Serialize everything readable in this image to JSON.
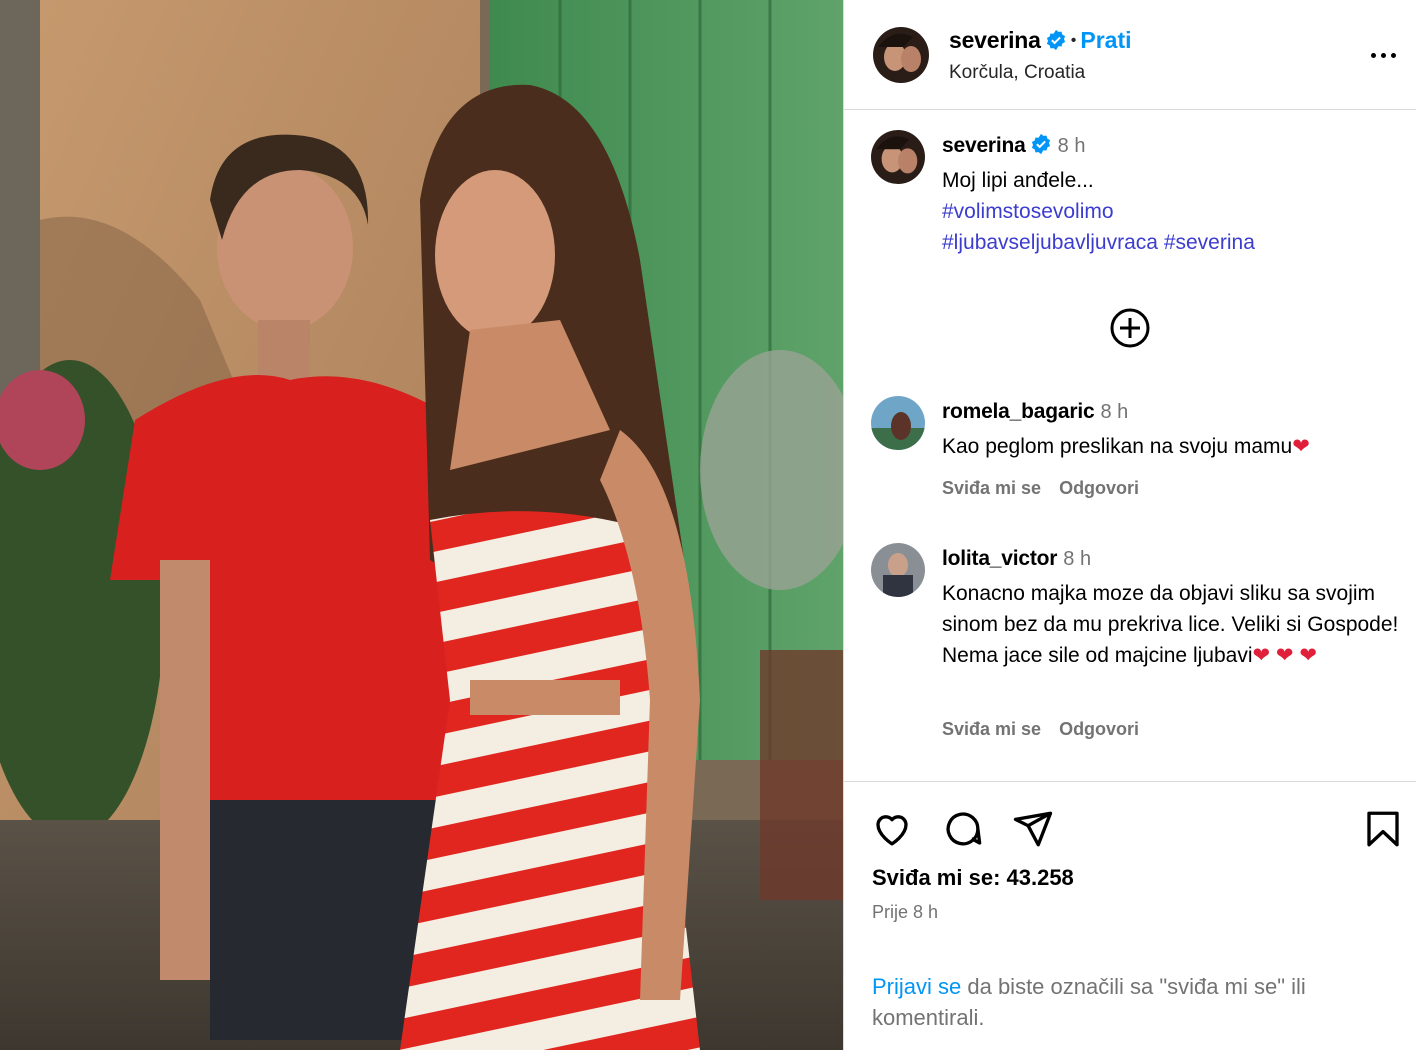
{
  "header": {
    "username": "severina",
    "separator": "•",
    "follow_label": "Prati",
    "location": "Korčula, Croatia",
    "more_icon": "more-horizontal-icon"
  },
  "caption": {
    "username": "severina",
    "time": "8 h",
    "text": "Moj lipi anđele...",
    "hashtags": [
      "#volimstosevolimo",
      "#ljubavseljubavljuvraca",
      "#severina"
    ]
  },
  "load_more_icon": "plus-circle-icon",
  "comments": [
    {
      "username": "romela_bagaric",
      "time": "8 h",
      "text": "Kao peglom preslikan na svoju mamu",
      "hearts": "❤",
      "like_label": "Sviđa mi se",
      "reply_label": "Odgovori"
    },
    {
      "username": "lolita_victor",
      "time": "8 h",
      "text": "Konacno majka moze da objavi sliku sa svojim sinom bez da mu prekriva lice. Veliki si Gospode! Nema jace sile od majcine ljubavi",
      "hearts": "❤ ❤ ❤",
      "like_label": "Sviđa mi se",
      "reply_label": "Odgovori"
    }
  ],
  "actions": {
    "icons": [
      "heart-icon",
      "comment-icon",
      "share-icon",
      "bookmark-icon"
    ],
    "likes": "Sviđa mi se: 43.258",
    "posted": "Prije 8 h",
    "login_link": "Prijavi se",
    "login_text": " da biste označili sa \"sviđa mi se\" ili komentirali."
  },
  "colors": {
    "link_blue": "#0095f6",
    "hashtag_blue": "#3c3ccf",
    "heart_red": "#e0203a",
    "muted_text": "#737373",
    "divider": "#dbdbdb"
  }
}
